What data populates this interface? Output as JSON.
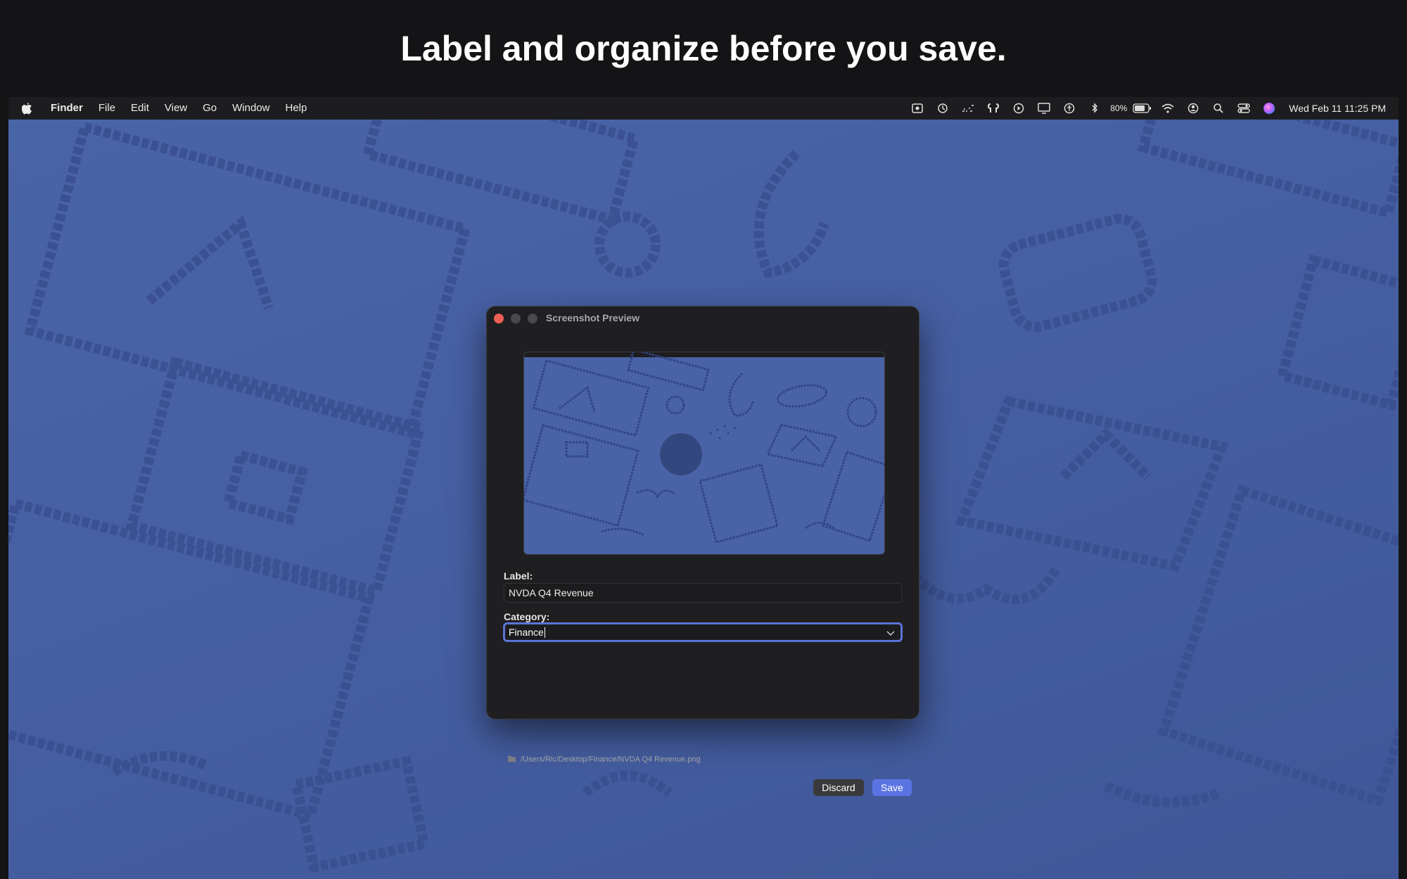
{
  "headline": "Label and organize before you save.",
  "menubar": {
    "app_name": "Finder",
    "menus": [
      "File",
      "Edit",
      "View",
      "Go",
      "Window",
      "Help"
    ],
    "status_icons": [
      "screenshot-icon",
      "time-machine-icon",
      "activity-icon",
      "airpods-icon",
      "play-icon",
      "display-icon",
      "accessibility-icon",
      "bluetooth-icon",
      "battery-icon",
      "wifi-icon",
      "user-icon",
      "search-icon",
      "control-center-icon",
      "siri-icon"
    ],
    "battery_percent": "80%",
    "clock": "Wed Feb 11  11:25 PM"
  },
  "dialog": {
    "title": "Screenshot Preview",
    "label_label": "Label:",
    "label_value": "NVDA Q4 Revenue",
    "category_label": "Category:",
    "category_value": "Finance",
    "save_path": "/Users/Ric/Desktop/Finance/NVDA Q4 Revenue.png",
    "discard_label": "Discard",
    "save_label": "Save"
  },
  "colors": {
    "wallpaper": "#4a64a8",
    "accent": "#5b74e3",
    "close_button": "#ec5f57"
  }
}
